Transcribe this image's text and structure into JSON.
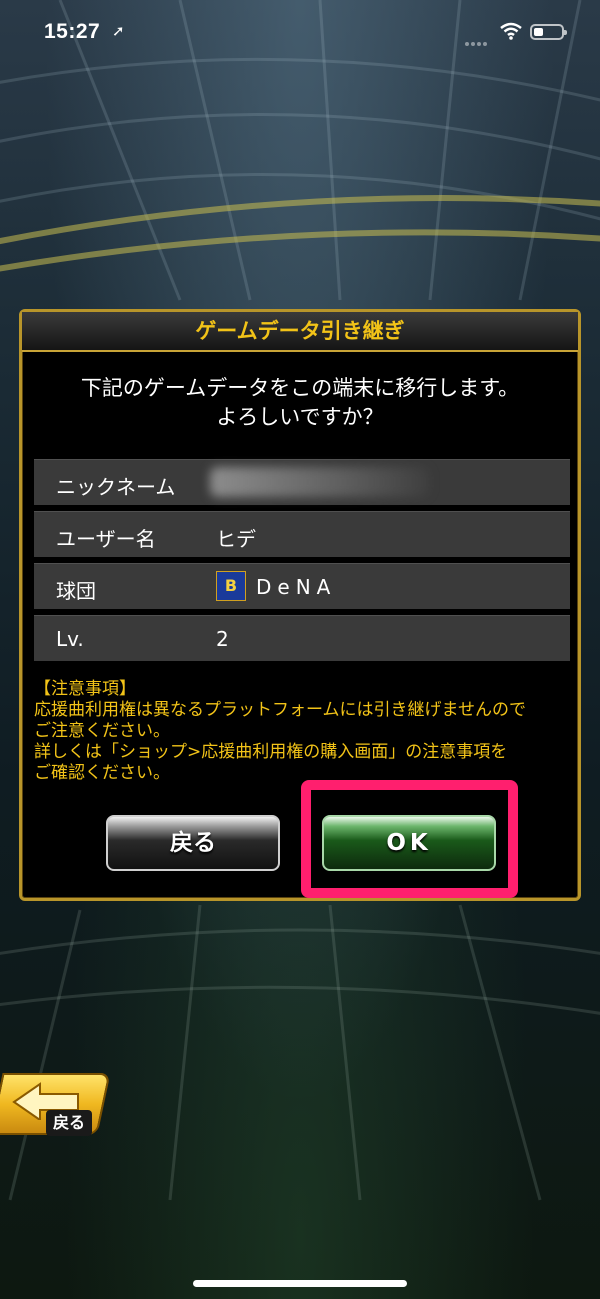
{
  "status_bar": {
    "time": "15:27",
    "location_glyph": "➚"
  },
  "dialog": {
    "title": "ゲームデータ引き継ぎ",
    "message_line1": "下記のゲームデータをこの端末に移行します。",
    "message_line2": "よろしいですか？",
    "rows": [
      {
        "label": "ニックネーム",
        "value": ""
      },
      {
        "label": "ユーザー名",
        "value": "ヒデ"
      },
      {
        "label": "球団",
        "value": "DeNA",
        "logo_text": "B"
      },
      {
        "label": "Lv.",
        "value": "2"
      }
    ],
    "notes_heading": "【注意事項】",
    "notes_line1": "応援曲利用権は異なるプラットフォームには引き継げませんので",
    "notes_line2": "ご注意ください。",
    "notes_line3": "詳しくは「ショップ>応援曲利用権の購入画面」の注意事項を",
    "notes_line4": "ご確認ください。",
    "back_button": "戻る",
    "ok_button": "OK"
  },
  "bottom_nav": {
    "back_label": "戻る"
  },
  "colors": {
    "accent_gold": "#f2c318",
    "highlight_pink": "#ff1f6e",
    "ok_green": "#1a5a1a"
  }
}
